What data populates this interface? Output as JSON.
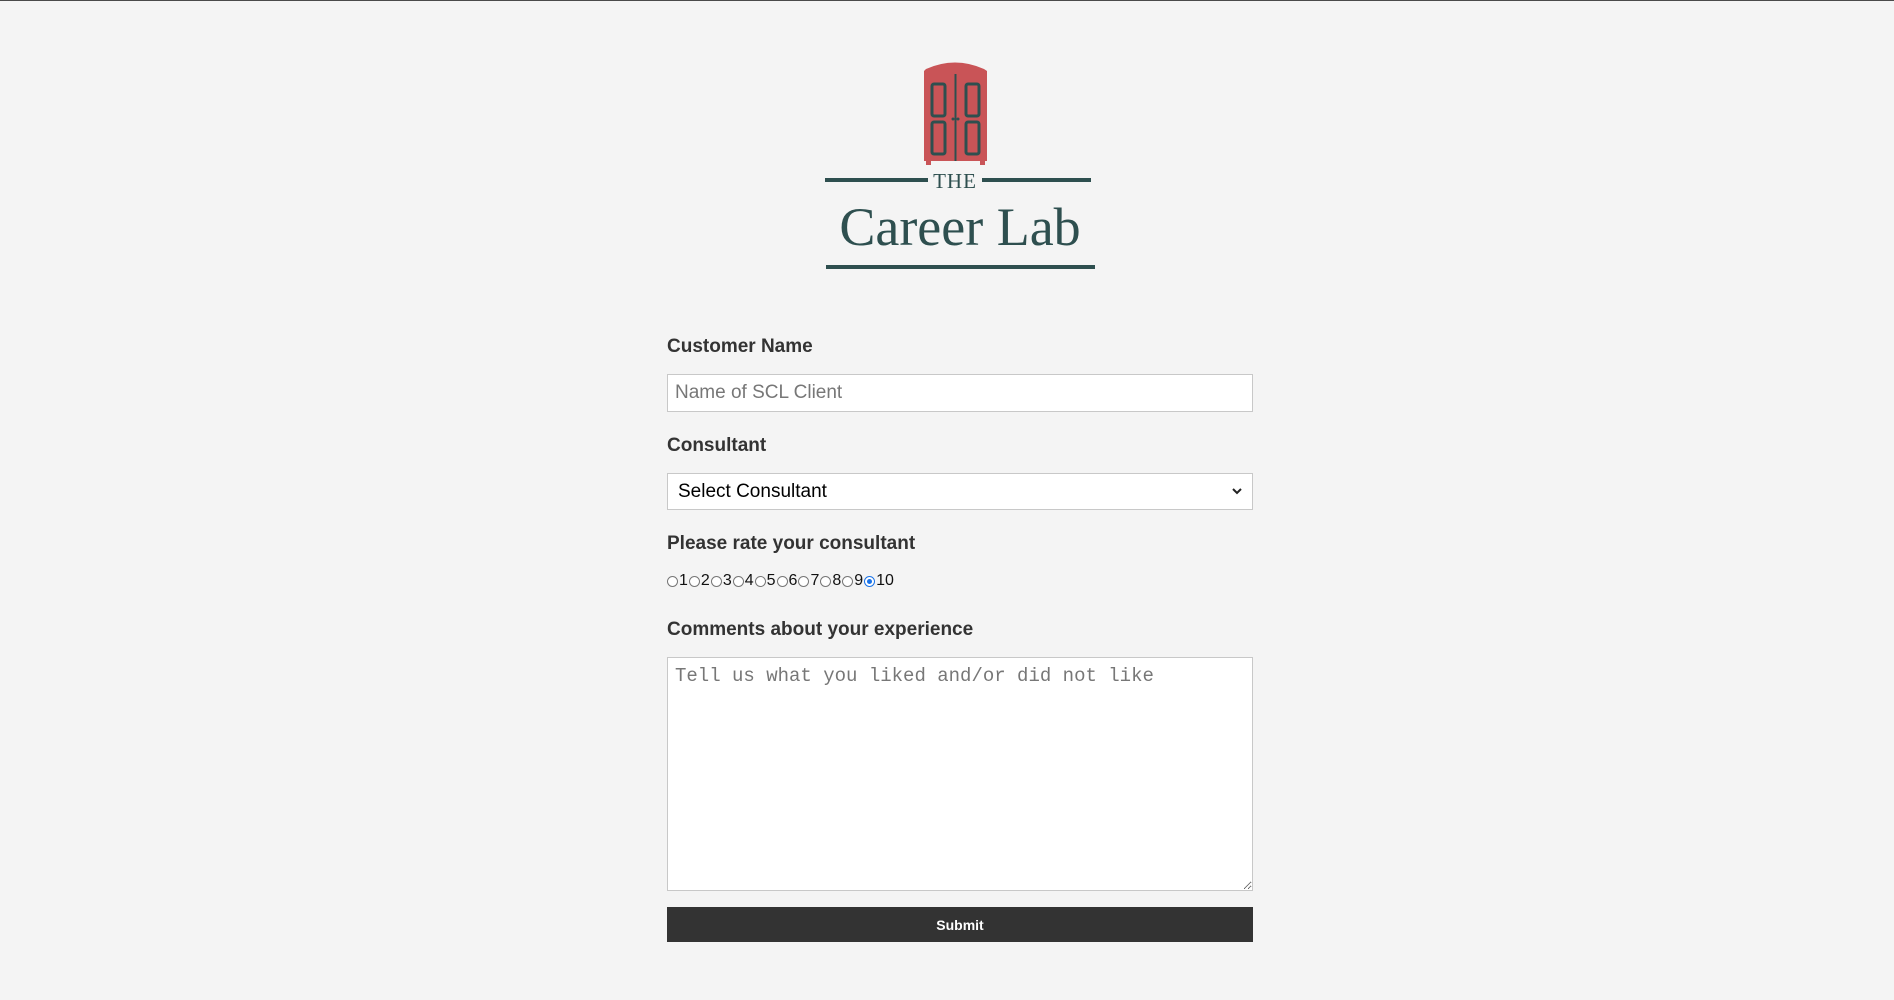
{
  "brand": {
    "top_text": "THE",
    "name": "Career Lab",
    "colors": {
      "door": "#c95457",
      "door_dark": "#2e4f4f",
      "text": "#2e4f4f"
    }
  },
  "form": {
    "customer_name": {
      "label": "Customer Name",
      "placeholder": "Name of SCL Client",
      "value": ""
    },
    "consultant": {
      "label": "Consultant",
      "selected": "Select Consultant"
    },
    "rating": {
      "label": "Please rate your consultant",
      "options": [
        "1",
        "2",
        "3",
        "4",
        "5",
        "6",
        "7",
        "8",
        "9",
        "10"
      ],
      "selected": "10"
    },
    "comments": {
      "label": "Comments about your experience",
      "placeholder": "Tell us what you liked and/or did not like"
    },
    "submit_label": "Submit"
  },
  "colors": {
    "page_bg": "#f4f4f4",
    "button_bg": "#333333",
    "radio_accent": "#1a73e8"
  }
}
